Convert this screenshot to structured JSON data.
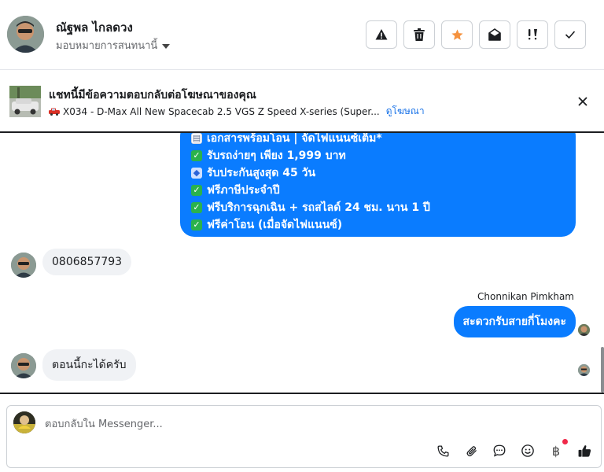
{
  "header": {
    "contact_name": "ณัฐพล ไกลดวง",
    "assign_label": "มอบหมายการสนทนานี้",
    "actions": [
      {
        "name": "report-button",
        "icon": "warning-icon"
      },
      {
        "name": "delete-button",
        "icon": "trash-icon"
      },
      {
        "name": "star-button",
        "icon": "star-icon"
      },
      {
        "name": "mark-unread-button",
        "icon": "open-envelope-icon"
      },
      {
        "name": "follow-up-button",
        "icon": "exclamation-icon"
      },
      {
        "name": "done-button",
        "icon": "check-icon"
      }
    ]
  },
  "ad": {
    "title": "แชทนี้มีข้อความตอบกลับต่อโฆษณาของคุณ",
    "subtitle": "X034 - D-Max All New Spacecab 2.5 VGS Z Speed X-series (Super...",
    "link": "ดูโฆษณา"
  },
  "messages": {
    "ad_reply_lines": [
      "เอกสารพร้อมโอน | จัดไฟแนนซ์เต็ม*",
      "รับรถง่ายๆ เพียง 1,999 บาท",
      "รับประกันสูงสุด 45 วัน",
      "ฟรีภาษีประจำปี",
      "ฟรีบริการฉุกเฉิน + รถสไลด์ 24 ชม. นาน 1 ปี",
      "ฟรีค่าโอน (เมื่อจัดไฟแนนซ์)"
    ],
    "customer_phone": "0806857793",
    "agent_name": "Chonnikan Pimkham",
    "agent_reply": "สะดวกรับสายกี่โมงคะ",
    "customer_reply": "ตอนนี้กะได้ครับ"
  },
  "composer": {
    "placeholder": "ตอบกลับใน Messenger...",
    "icons": [
      "phone-icon",
      "paperclip-icon",
      "chat-bubble-icon",
      "smiley-icon",
      "baht-icon",
      "thumbs-up-icon"
    ]
  },
  "colors": {
    "accent_blue": "#0a7cff",
    "star_orange": "#f5923e",
    "link_blue": "#1a73e8"
  }
}
